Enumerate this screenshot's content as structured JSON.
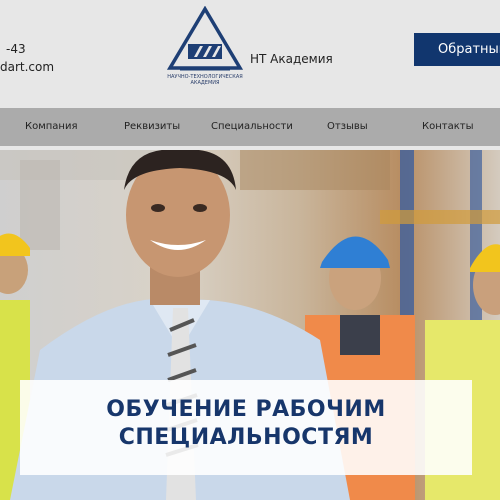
{
  "header": {
    "phone_fragment": "-43",
    "email_fragment": "dart.com",
    "logo_caption": "Научно-технологическая академия",
    "brand_name": "НТ Академия",
    "cta_label": "Обратный"
  },
  "nav": {
    "items": [
      {
        "label": "Компания"
      },
      {
        "label": "Реквизиты"
      },
      {
        "label": "Специальности"
      },
      {
        "label": "Отзывы"
      },
      {
        "label": "Контакты"
      }
    ]
  },
  "hero": {
    "title_line1": "ОБУЧЕНИЕ РАБОЧИМ",
    "title_line2": "СПЕЦИАЛЬНОСТЯМ"
  },
  "colors": {
    "header_bg": "#e7e7e7",
    "nav_bg": "#ababab",
    "cta_bg": "#11366e",
    "title_color": "#17366b"
  }
}
